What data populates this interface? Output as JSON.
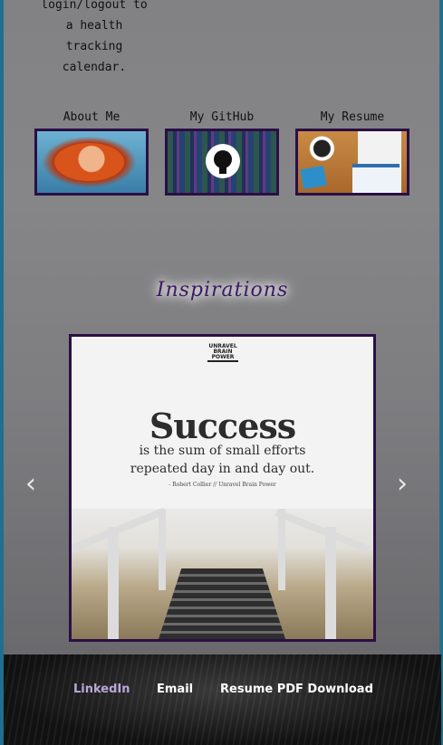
{
  "intro": {
    "lines": [
      "login/logout to",
      "a health",
      "tracking",
      "calendar."
    ]
  },
  "links": [
    {
      "label": "About Me",
      "image": "merida-portrait"
    },
    {
      "label": "My GitHub",
      "image": "github-logo-on-code"
    },
    {
      "label": "My Resume",
      "image": "desk-with-resume"
    }
  ],
  "inspirations": {
    "heading": "Inspirations"
  },
  "carousel": {
    "brand": [
      "UNRAVEL",
      "BRAIN",
      "POWER"
    ],
    "title": "Success",
    "line1": "is the sum of small efforts",
    "line2": "repeated day in and day out.",
    "attribution": "- Robert Collier // Unravel Brain Power",
    "prev_icon": "chevron-left-icon",
    "next_icon": "chevron-right-icon",
    "prev_glyph": "‹",
    "next_glyph": "›"
  },
  "footer": {
    "linkedin": "LinkedIn",
    "email": "Email",
    "resume": "Resume PDF Download"
  },
  "colors": {
    "frame_border": "#2a0f45",
    "heading_purple": "#3b1a66",
    "linkedin_visited": "#b9a8d8"
  }
}
